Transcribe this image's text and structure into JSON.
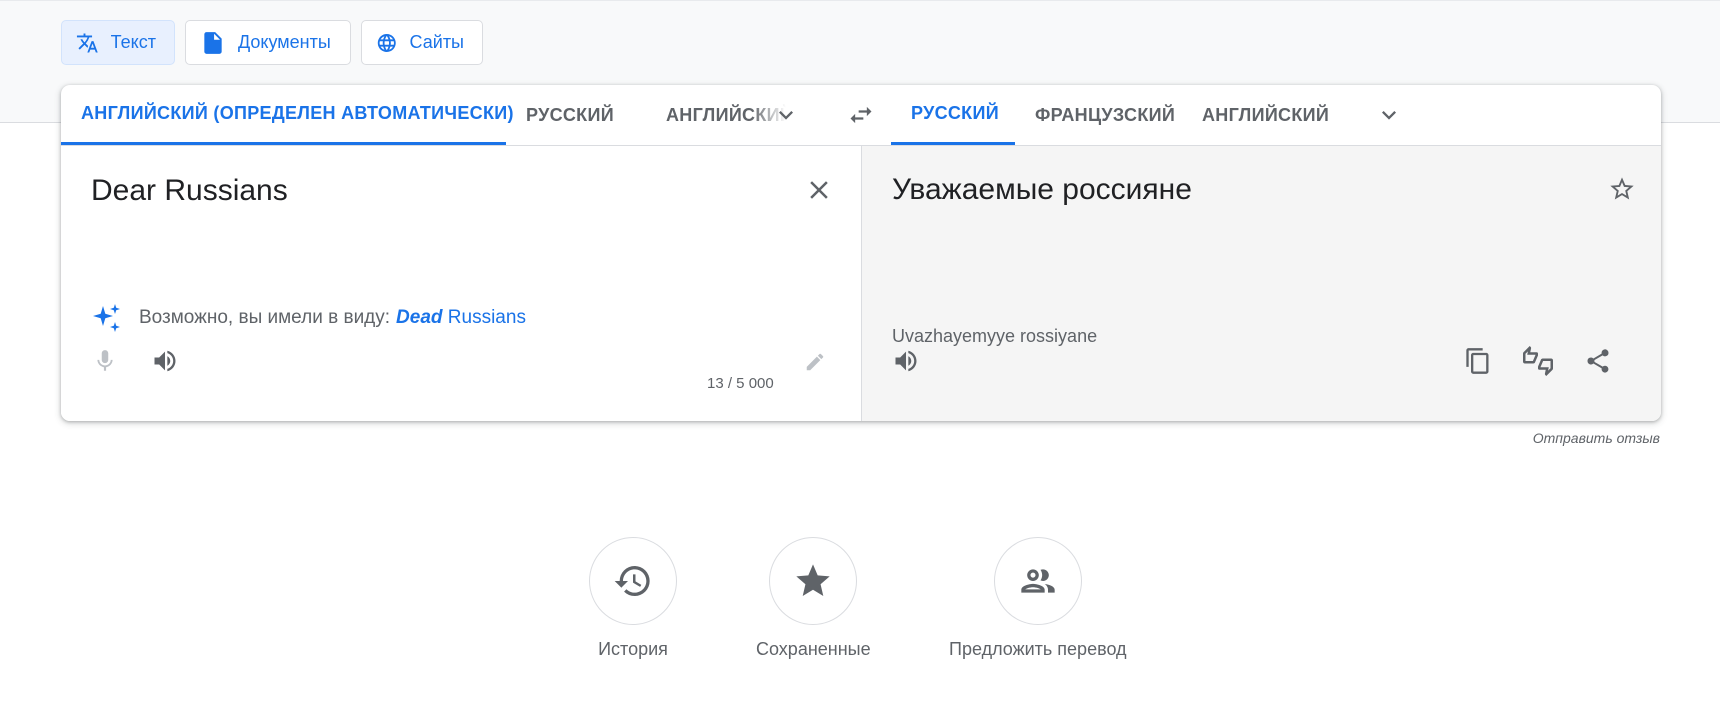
{
  "modes": [
    {
      "label": "Текст",
      "icon": "translate-icon",
      "active": true
    },
    {
      "label": "Документы",
      "icon": "document-icon",
      "active": false
    },
    {
      "label": "Сайты",
      "icon": "globe-icon",
      "active": false
    }
  ],
  "source_langs": [
    {
      "label": "АНГЛИЙСКИЙ (ОПРЕДЕЛЕН АВТОМАТИЧЕСКИ)",
      "active": true
    },
    {
      "label": "РУССКИЙ",
      "active": false
    },
    {
      "label": "АНГЛИЙСКИЙ",
      "active": false
    }
  ],
  "target_langs": [
    {
      "label": "РУССКИЙ",
      "active": true
    },
    {
      "label": "ФРАНЦУЗСКИЙ",
      "active": false
    },
    {
      "label": "АНГЛИЙСКИЙ",
      "active": false
    }
  ],
  "source": {
    "text": "Dear Russians",
    "suggestion_prefix": "Возможно, вы имели в виду:",
    "suggestion_bold": "Dead",
    "suggestion_rest": "Russians",
    "char_count": "13 / 5 000"
  },
  "target": {
    "text": "Уважаемые россияне",
    "transliteration": "Uvazhayemyye rossiyane"
  },
  "feedback_label": "Отправить отзыв",
  "bottom": [
    {
      "label": "История",
      "icon": "history-icon"
    },
    {
      "label": "Сохраненные",
      "icon": "star-filled-icon"
    },
    {
      "label": "Предложить перевод",
      "icon": "people-icon"
    }
  ],
  "colors": {
    "accent": "#1a73e8",
    "text": "#202124",
    "muted": "#5f6368"
  }
}
